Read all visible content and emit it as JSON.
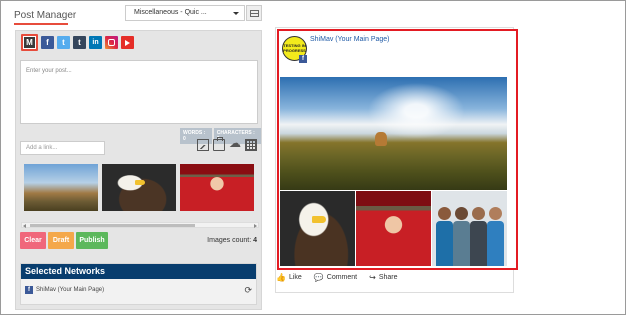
{
  "header": {
    "title": "Post Manager",
    "select_value": "Miscellaneous - Quic ..."
  },
  "composer": {
    "placeholder": "Enter your post...",
    "words_label": "WORDS : 0",
    "characters_label": "CHARACTERS : 0",
    "link_placeholder": "Add a link...",
    "clear_label": "Clear",
    "draft_label": "Draft",
    "publish_label": "Publish",
    "images_count_label": "Images count:",
    "images_count_value": "4"
  },
  "networks": {
    "title": "Selected Networks",
    "items": [
      {
        "label": "ShiMav (Your Main Page)"
      }
    ]
  },
  "preview": {
    "page_name": "ShiMav (Your Main Page)",
    "avatar_text": "TESTING IN PROGRESS",
    "actions": {
      "like": "Like",
      "comment": "Comment",
      "share": "Share"
    }
  },
  "colors": {
    "accent_red": "#e31b23",
    "networks_header": "#083d6e",
    "clear": "#f0677b",
    "draft": "#f4a84a",
    "publish": "#5cb85c",
    "facebook": "#3b5998"
  },
  "icons": [
    "m-icon",
    "facebook-icon",
    "twitter-icon",
    "tumblr-icon",
    "linkedin-icon",
    "instagram-icon",
    "youtube-icon",
    "image-icon",
    "briefcase-icon",
    "cloud-upload-icon",
    "grid-icon",
    "refresh-icon"
  ]
}
